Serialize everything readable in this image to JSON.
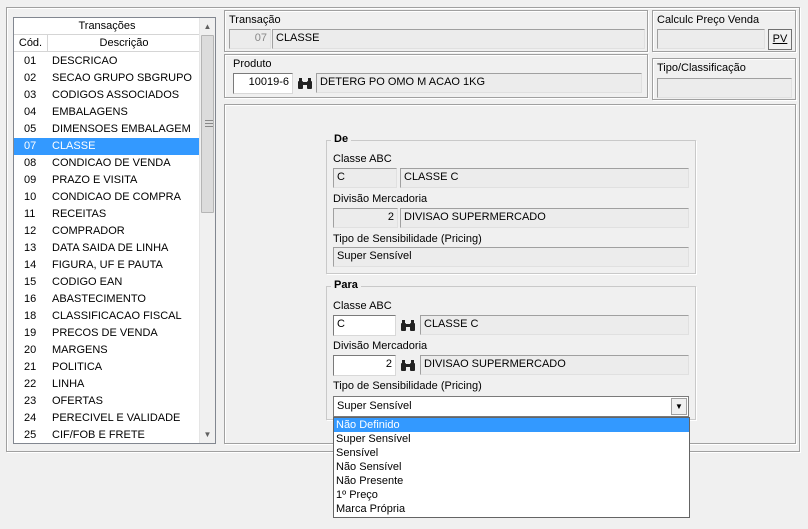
{
  "transacoes_panel": {
    "title": "Transações",
    "col_code": "Cód.",
    "col_desc": "Descrição",
    "rows": [
      {
        "code": "01",
        "desc": "DESCRICAO"
      },
      {
        "code": "02",
        "desc": "SECAO GRUPO SBGRUPO"
      },
      {
        "code": "03",
        "desc": "CODIGOS ASSOCIADOS"
      },
      {
        "code": "04",
        "desc": "EMBALAGENS"
      },
      {
        "code": "05",
        "desc": "DIMENSOES EMBALAGEM"
      },
      {
        "code": "07",
        "desc": "CLASSE"
      },
      {
        "code": "08",
        "desc": "CONDICAO DE VENDA"
      },
      {
        "code": "09",
        "desc": "PRAZO E VISITA"
      },
      {
        "code": "10",
        "desc": "CONDICAO DE COMPRA"
      },
      {
        "code": "11",
        "desc": "RECEITAS"
      },
      {
        "code": "12",
        "desc": "COMPRADOR"
      },
      {
        "code": "13",
        "desc": "DATA SAIDA DE LINHA"
      },
      {
        "code": "14",
        "desc": "FIGURA, UF E PAUTA"
      },
      {
        "code": "15",
        "desc": "CODIGO EAN"
      },
      {
        "code": "16",
        "desc": "ABASTECIMENTO"
      },
      {
        "code": "18",
        "desc": "CLASSIFICACAO FISCAL"
      },
      {
        "code": "19",
        "desc": "PRECOS DE VENDA"
      },
      {
        "code": "20",
        "desc": "MARGENS"
      },
      {
        "code": "21",
        "desc": "POLITICA"
      },
      {
        "code": "22",
        "desc": "LINHA"
      },
      {
        "code": "23",
        "desc": "OFERTAS"
      },
      {
        "code": "24",
        "desc": "PERECIVEL E VALIDADE"
      },
      {
        "code": "25",
        "desc": "CIF/FOB E FRETE"
      }
    ],
    "selected_code": "07"
  },
  "transacao": {
    "label": "Transação",
    "code": "07",
    "desc": "CLASSE"
  },
  "produto": {
    "label": "Produto",
    "code": "10019-6",
    "desc": "DETERG PO OMO M ACAO 1KG"
  },
  "calculo": {
    "label": "Calculc Preço Venda",
    "value": "",
    "button": "PV"
  },
  "tipo_classificacao": {
    "label": "Tipo/Classificação",
    "value": ""
  },
  "de": {
    "title": "De",
    "classe_label": "Classe ABC",
    "classe_code": "C",
    "classe_desc": "CLASSE C",
    "divisao_label": "Divisão Mercadoria",
    "divisao_code": "2",
    "divisao_desc": "DIVISAO SUPERMERCADO",
    "sens_label": "Tipo de Sensibilidade (Pricing)",
    "sens_value": "Super Sensível"
  },
  "para": {
    "title": "Para",
    "classe_label": "Classe ABC",
    "classe_code": "C",
    "classe_desc": "CLASSE C",
    "divisao_label": "Divisão Mercadoria",
    "divisao_code": "2",
    "divisao_desc": "DIVISAO SUPERMERCADO",
    "sens_label": "Tipo de Sensibilidade (Pricing)",
    "sens_value": "Super Sensível",
    "sens_options": [
      "Não Definido",
      "Super Sensível",
      "Sensível",
      "Não Sensível",
      "Não Presente",
      "1º Preço",
      "Marca Própria"
    ],
    "highlighted_option": "Não Definido"
  },
  "colors": {
    "selection": "#3399ff",
    "background": "#f0f0f0"
  }
}
